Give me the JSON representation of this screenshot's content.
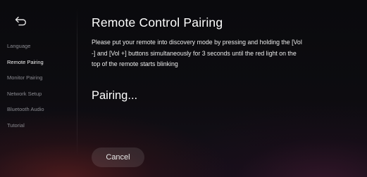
{
  "sidebar": {
    "back_icon": "back-arrow-icon",
    "items": [
      {
        "label": "Language",
        "active": false
      },
      {
        "label": "Remote Pairing",
        "active": true
      },
      {
        "label": "Monitor Pairing",
        "active": false
      },
      {
        "label": "Network Setup",
        "active": false
      },
      {
        "label": "Bluetooth Audio",
        "active": false
      },
      {
        "label": "Tutorial",
        "active": false
      }
    ]
  },
  "main": {
    "title": "Remote Control Pairing",
    "instructions": "Please put your remote into discovery mode by pressing and holding the [Vol -] and [Vol +] buttons simultaneously for 3 seconds until the red light on the top of the remote starts blinking",
    "status": "Pairing...",
    "cancel_label": "Cancel"
  },
  "colors": {
    "background": "#0d0c10",
    "text_primary": "#ffffff",
    "text_muted": "#8a8a90",
    "button_bg": "rgba(255,255,255,0.10)"
  }
}
